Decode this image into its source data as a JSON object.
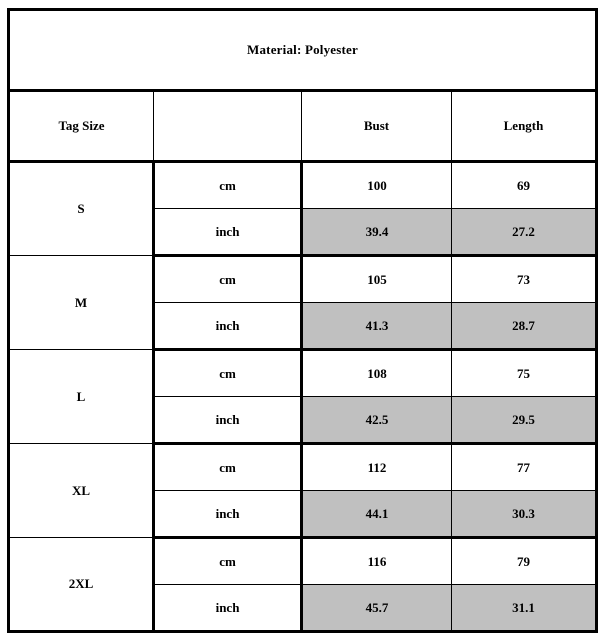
{
  "title": "Material: Polyester",
  "header": {
    "tag_size": "Tag Size",
    "unit": "",
    "bust": "Bust",
    "length": "Length"
  },
  "units": {
    "cm": "cm",
    "inch": "inch"
  },
  "colors": {
    "shaded_cell": "#c0c0c0",
    "border": "#000000",
    "background": "#ffffff"
  },
  "rows": [
    {
      "size": "S",
      "cm": {
        "bust": "100",
        "length": "69"
      },
      "inch": {
        "bust": "39.4",
        "length": "27.2"
      }
    },
    {
      "size": "M",
      "cm": {
        "bust": "105",
        "length": "73"
      },
      "inch": {
        "bust": "41.3",
        "length": "28.7"
      }
    },
    {
      "size": "L",
      "cm": {
        "bust": "108",
        "length": "75"
      },
      "inch": {
        "bust": "42.5",
        "length": "29.5"
      }
    },
    {
      "size": "XL",
      "cm": {
        "bust": "112",
        "length": "77"
      },
      "inch": {
        "bust": "44.1",
        "length": "30.3"
      }
    },
    {
      "size": "2XL",
      "cm": {
        "bust": "116",
        "length": "79"
      },
      "inch": {
        "bust": "45.7",
        "length": "31.1"
      }
    }
  ]
}
